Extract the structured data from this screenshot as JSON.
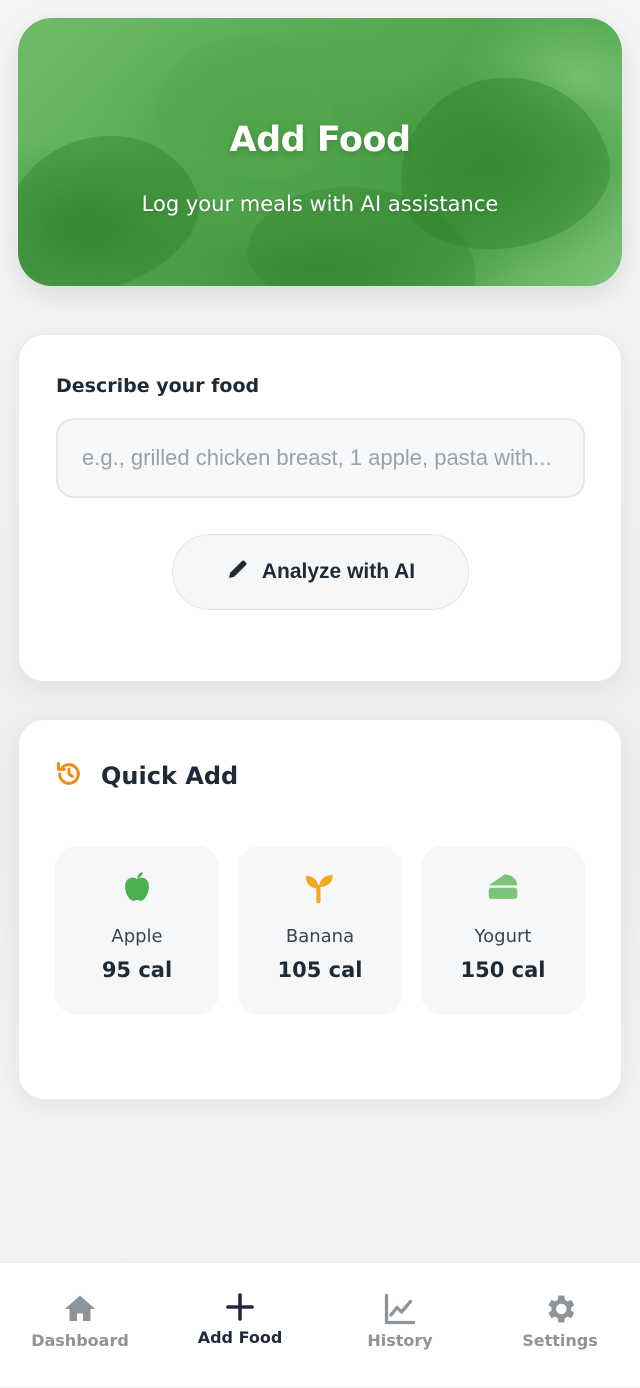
{
  "hero": {
    "title": "Add Food",
    "subtitle": "Log your meals with AI assistance"
  },
  "form": {
    "label": "Describe your food",
    "input_placeholder": "e.g., grilled chicken breast, 1 apple, pasta with...",
    "input_value": "",
    "analyze_label": "Analyze with AI",
    "analyze_icon": "pencil-icon"
  },
  "quick_add": {
    "title": "Quick Add",
    "icon": "history-icon",
    "items": [
      {
        "name": "Apple",
        "calories": "95 cal",
        "icon": "apple-icon",
        "color": "#4caf50"
      },
      {
        "name": "Banana",
        "calories": "105 cal",
        "icon": "seedling-icon",
        "color": "#f5a623"
      },
      {
        "name": "Yogurt",
        "calories": "150 cal",
        "icon": "cheese-icon",
        "color": "#7cc47a"
      }
    ]
  },
  "tabs": [
    {
      "label": "Dashboard",
      "icon": "home-icon",
      "active": false
    },
    {
      "label": "Add Food",
      "icon": "plus-icon",
      "active": true
    },
    {
      "label": "History",
      "icon": "chart-line-icon",
      "active": false
    },
    {
      "label": "Settings",
      "icon": "gear-icon",
      "active": false
    }
  ],
  "colors": {
    "accent_orange": "#f28c1b",
    "hero_green": "#5aab55",
    "text_dark": "#1f2a37",
    "tab_inactive": "#8e949c"
  }
}
